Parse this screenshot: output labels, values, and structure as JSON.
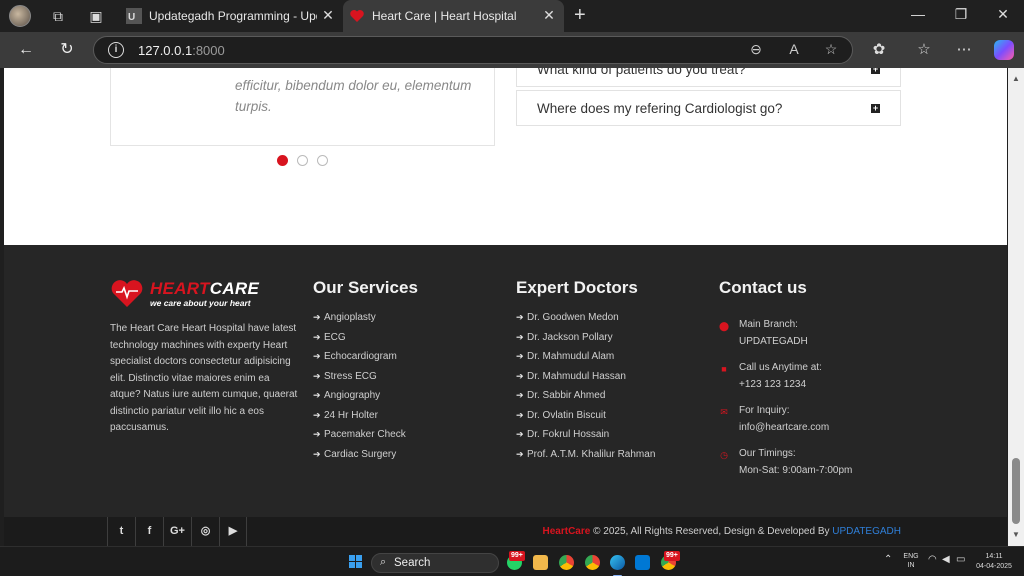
{
  "browser": {
    "tabs": [
      {
        "title": "Updategadh Programming - Upd",
        "favicon": "updategadh-favicon"
      },
      {
        "title": "Heart Care | Heart Hospital",
        "favicon": "heart-favicon",
        "active": true
      }
    ],
    "url_host": "127.0.0.1",
    "url_port": ":8000"
  },
  "testimonial": {
    "quote": "efficitur, bibendum dolor eu, elementum turpis.",
    "pager_active_index": 0,
    "pager_count": 3
  },
  "faq": {
    "items": [
      {
        "question": "What kind of patients do you treat?"
      },
      {
        "question": "Where does my refering Cardiologist go?"
      }
    ]
  },
  "footer": {
    "logo": {
      "name_part1": "HEART",
      "name_part2": "CARE",
      "tagline": "we care about your heart"
    },
    "about": "The Heart Care Heart Hospital have latest technology machines with experty Heart specialist doctors consectetur adipisicing elit. Distinctio vitae maiores enim ea atque? Natus iure autem cumque, quaerat distinctio pariatur velit illo hic a eos paccusamus.",
    "services_title": "Our Services",
    "services": [
      "Angioplasty",
      "ECG",
      "Echocardiogram",
      "Stress ECG",
      "Angiography",
      "24 Hr Holter",
      "Pacemaker Check",
      "Cardiac Surgery"
    ],
    "doctors_title": "Expert Doctors",
    "doctors": [
      "Dr. Goodwen Medon",
      "Dr. Jackson Pollary",
      "Dr. Mahmudul Alam",
      "Dr. Mahmudul Hassan",
      "Dr. Sabbir Ahmed",
      "Dr. Ovlatin Biscuit",
      "Dr. Fokrul Hossain",
      "Prof. A.T.M. Khalilur Rahman"
    ],
    "contact_title": "Contact us",
    "contact": [
      {
        "icon": "map-marker-icon",
        "label": "Main Branch:",
        "value": "UPDATEGADH"
      },
      {
        "icon": "phone-icon",
        "label": "Call us Anytime at:",
        "value": "+123 123 1234"
      },
      {
        "icon": "envelope-icon",
        "label": "For Inquiry:",
        "value": "info@heartcare.com"
      },
      {
        "icon": "clock-icon",
        "label": "Our Timings:",
        "value": "Mon-Sat: 9:00am-7:00pm"
      }
    ],
    "social": [
      {
        "icon": "twitter-icon",
        "glyph": "t"
      },
      {
        "icon": "facebook-icon",
        "glyph": "f"
      },
      {
        "icon": "google-plus-icon",
        "glyph": "G+"
      },
      {
        "icon": "instagram-icon",
        "glyph": "◎"
      },
      {
        "icon": "youtube-icon",
        "glyph": "▶"
      }
    ],
    "copyright_brand": "HeartCare",
    "copyright_text": " © 2025, All Rights Reserved, Design & Developed By ",
    "copyright_dev": "UPDATEGADH"
  },
  "taskbar": {
    "search_label": "Search",
    "badge_1": "99+",
    "badge_2": "99+",
    "lang_1": "ENG",
    "lang_2": "IN",
    "time": "14:11",
    "date": "04-04-2025"
  },
  "colors": {
    "brand_red": "#d8141f",
    "footer_bg": "#262626",
    "link_blue": "#2f7fd8"
  }
}
